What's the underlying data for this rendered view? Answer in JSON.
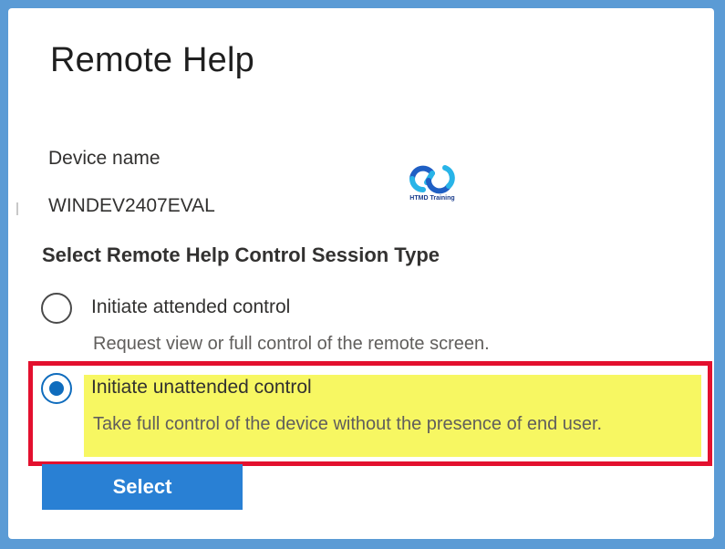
{
  "page": {
    "title": "Remote Help",
    "device": {
      "label": "Device name",
      "value": "WINDEV2407EVAL"
    },
    "section_title": "Select Remote Help Control Session Type",
    "options": [
      {
        "label": "Initiate attended control",
        "description": "Request view or full control of the remote screen.",
        "selected": false
      },
      {
        "label": "Initiate unattended control",
        "description": "Take full control of the device without the presence of end user.",
        "selected": true
      }
    ],
    "select_button": "Select"
  },
  "watermark": {
    "text": "HTMD Training"
  },
  "colors": {
    "frame_border": "#5b9bd5",
    "accent": "#0f6cbd",
    "button": "#2980d4",
    "highlight": "#f7f762",
    "annotation_box": "#e3102e"
  }
}
